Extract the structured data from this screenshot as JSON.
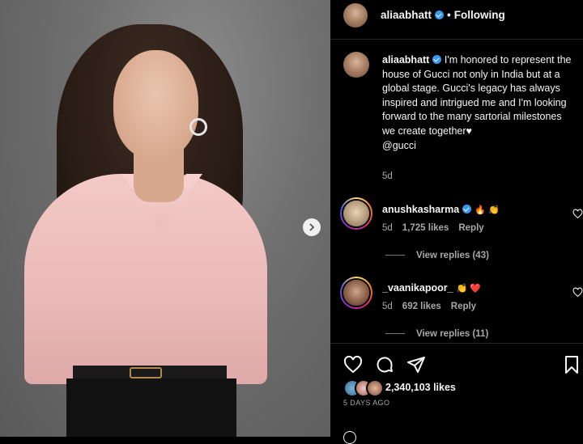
{
  "post": {
    "username": "aliaabhatt",
    "follow_status": "Following",
    "separator": "•",
    "caption": "I'm honored to represent the house of Gucci not only in India but at a global stage. Gucci's legacy has always inspired and intrigued me and I'm looking forward to the many sartorial milestones we create together♥",
    "caption_mention": "@gucci",
    "caption_time": "5d",
    "like_count": "2,340,103 likes",
    "posted_ago": "5 DAYS AGO"
  },
  "comments": [
    {
      "username": "anushkasharma",
      "emojis": "🔥 👏",
      "time": "5d",
      "likes": "1,725 likes",
      "reply_label": "Reply",
      "view_replies": "View replies (43)"
    },
    {
      "username": "_vaanikapoor_",
      "emojis": "👏 ❤️",
      "time": "5d",
      "likes": "692 likes",
      "reply_label": "Reply",
      "view_replies": "View replies (11)"
    }
  ],
  "icons": {
    "verified": "verified-badge-icon",
    "next": "chevron-right-icon",
    "like": "heart-icon",
    "comment": "comment-icon",
    "share": "paper-plane-icon",
    "save": "bookmark-icon"
  },
  "colors": {
    "background": "#000000",
    "text": "#f5f5f5",
    "secondary": "#a8a8a8",
    "verified": "#3897f0"
  }
}
